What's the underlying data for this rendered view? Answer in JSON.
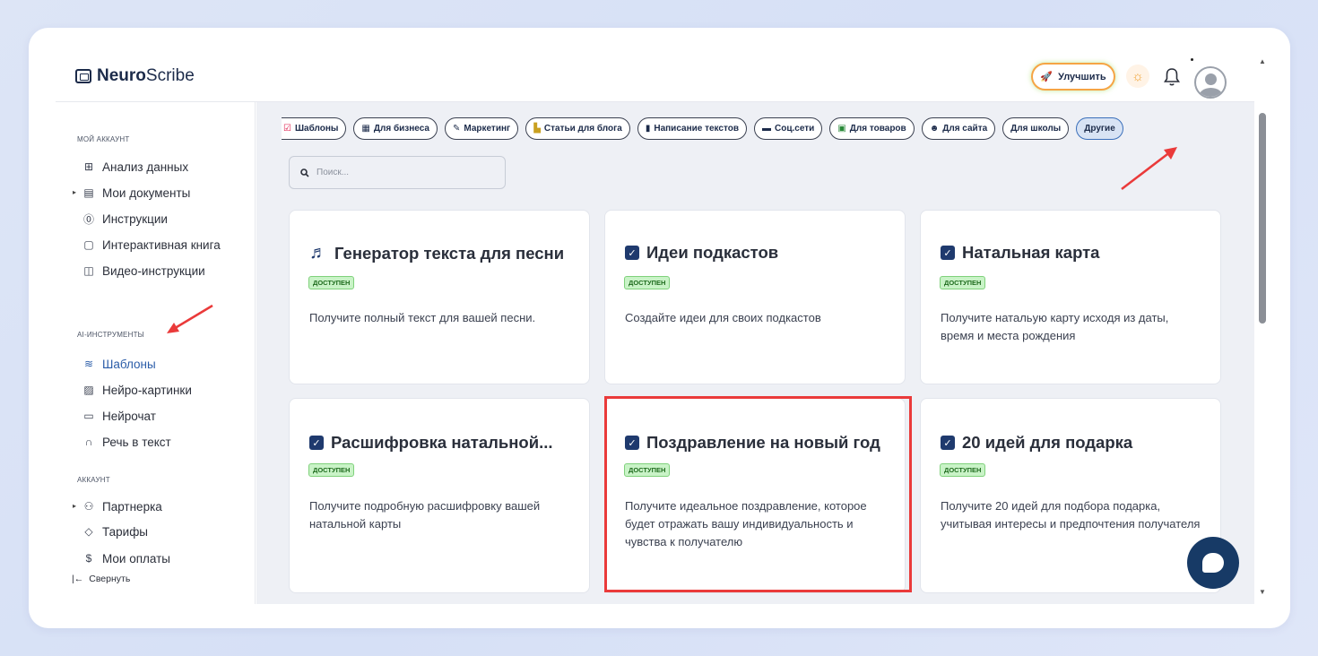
{
  "app": {
    "name_bold": "Neuro",
    "name_rest": "Scribe"
  },
  "header": {
    "upgrade_label": "Улучшить"
  },
  "sidebar": {
    "section_account": "МОЙ АККАУНТ",
    "section_ai": "AI-ИНСТРУМЕНТЫ",
    "section_acc2": "АККАУНТ",
    "items": [
      {
        "label": "Анализ данных",
        "icon": "grid-icon"
      },
      {
        "label": "Мои документы",
        "icon": "document-icon"
      },
      {
        "label": "Инструкции",
        "icon": "help-icon"
      },
      {
        "label": "Интерактивная книга",
        "icon": "book-icon"
      },
      {
        "label": "Видео-инструкции",
        "icon": "video-icon"
      },
      {
        "label": "Шаблоны",
        "icon": "layers-icon"
      },
      {
        "label": "Нейро-картинки",
        "icon": "image-icon"
      },
      {
        "label": "Нейрочат",
        "icon": "chat-icon"
      },
      {
        "label": "Речь в текст",
        "icon": "headphones-icon"
      },
      {
        "label": "Партнерка",
        "icon": "users-icon"
      },
      {
        "label": "Тарифы",
        "icon": "tag-icon"
      },
      {
        "label": "Мои оплаты",
        "icon": "dollar-icon"
      }
    ],
    "collapse_label": "Свернуть"
  },
  "filters": [
    {
      "label": "Шаблоны",
      "icon": "☑"
    },
    {
      "label": "Для бизнеса",
      "icon": "▦"
    },
    {
      "label": "Маркетинг",
      "icon": "📝"
    },
    {
      "label": "Статьи для блога",
      "icon": "🏙"
    },
    {
      "label": "Написание текстов",
      "icon": "▮"
    },
    {
      "label": "Соц.сети",
      "icon": "▬"
    },
    {
      "label": "Для товаров",
      "icon": "▣"
    },
    {
      "label": "Для сайта",
      "icon": "☻"
    },
    {
      "label": "Для школы",
      "icon": ""
    },
    {
      "label": "Другие",
      "icon": ""
    }
  ],
  "search": {
    "placeholder": "Поиск..."
  },
  "cards": [
    {
      "title": "Генератор текста для песни",
      "badge": "ДОСТУПЕН",
      "desc": "Получите полный текст для вашей песни.",
      "icon": "music-icon"
    },
    {
      "title": "Идеи подкастов",
      "badge": "ДОСТУПЕН",
      "desc": "Создайте идеи для своих подкастов",
      "icon": "check-icon"
    },
    {
      "title": "Натальная карта",
      "badge": "ДОСТУПЕН",
      "desc": "Получите натальую карту исходя из даты, время и места рождения",
      "icon": "check-icon"
    },
    {
      "title": "Расшифровка натальной...",
      "badge": "ДОСТУПЕН",
      "desc": "Получите подробную расшифровку вашей натальной карты",
      "icon": "check-icon"
    },
    {
      "title": "Поздравление на новый год",
      "badge": "ДОСТУПЕН",
      "desc": "Получите идеальное поздравление, которое будет отражать вашу индивидуальность и чувства к получателю",
      "icon": "check-icon"
    },
    {
      "title": "20 идей для подарка",
      "badge": "ДОСТУПЕН",
      "desc": "Получите 20 идей для подбора подарка, учитывая интересы и предпочтения получателя",
      "icon": "check-icon"
    }
  ],
  "colors": {
    "accent": "#1f3a6e",
    "highlight": "#ea3a3a",
    "badge_bg": "#c9f3c7"
  }
}
